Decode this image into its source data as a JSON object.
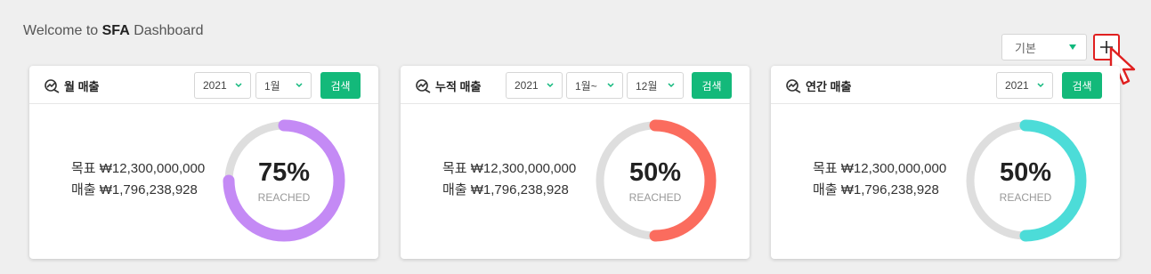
{
  "header": {
    "welcome_prefix": "Welcome to ",
    "welcome_brand": "SFA",
    "welcome_suffix": " Dashboard"
  },
  "toolbar": {
    "view_select_value": "기본",
    "add_label": "+"
  },
  "colors": {
    "accent": "#13b97a",
    "highlight": "#e02020"
  },
  "cards": [
    {
      "title": "월 매출",
      "filters": [
        "2021",
        "1월"
      ],
      "search_label": "검색",
      "target": "목표 ₩12,300,000,000",
      "sales": "매출 ₩1,796,238,928",
      "percent_text": "75%",
      "percent": 0.75,
      "reached_label": "REACHED",
      "color": "#c48af5"
    },
    {
      "title": "누적 매출",
      "filters": [
        "2021",
        "1월~",
        "12월"
      ],
      "search_label": "검색",
      "target": "목표 ₩12,300,000,000",
      "sales": "매출 ₩1,796,238,928",
      "percent_text": "50%",
      "percent": 0.5,
      "reached_label": "REACHED",
      "color": "#fb6c5e"
    },
    {
      "title": "연간 매출",
      "filters": [
        "2021"
      ],
      "search_label": "검색",
      "target": "목표 ₩12,300,000,000",
      "sales": "매출 ₩1,796,238,928",
      "percent_text": "50%",
      "percent": 0.5,
      "reached_label": "REACHED",
      "color": "#4cdcd8"
    }
  ]
}
